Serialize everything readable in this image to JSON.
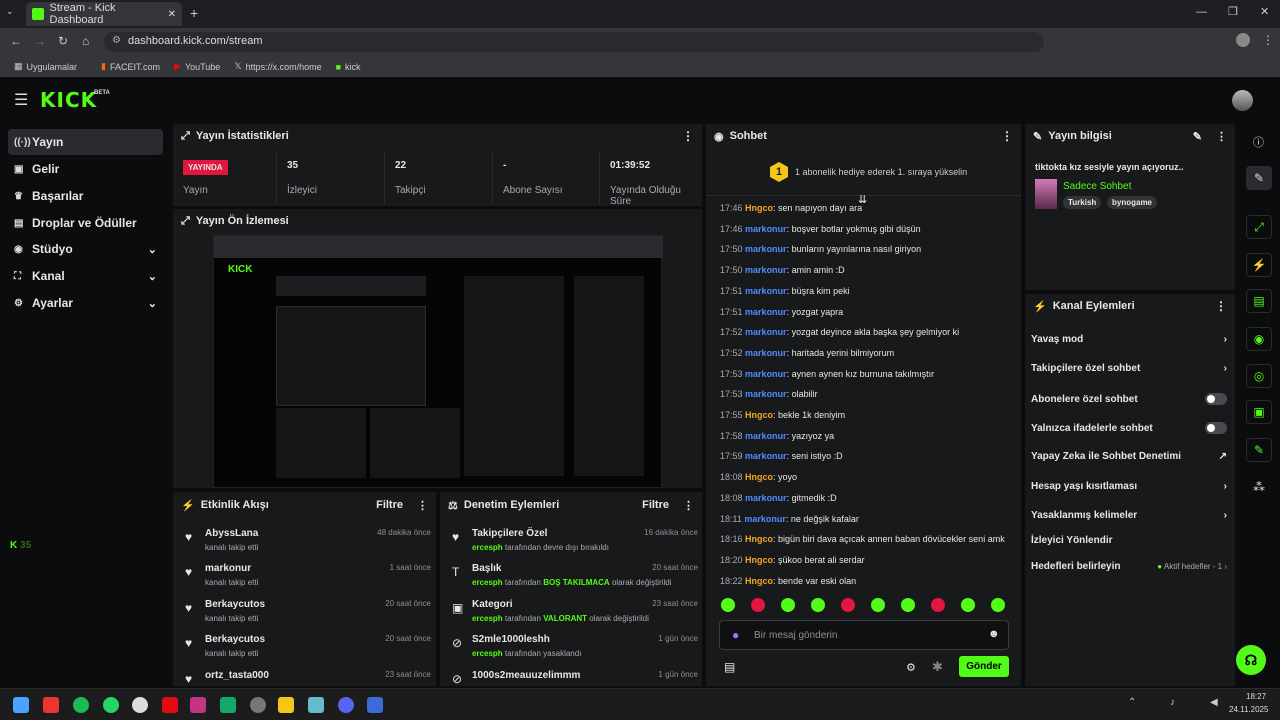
{
  "browser": {
    "tab_title": "Stream - Kick Dashboard",
    "url": "dashboard.kick.com/stream",
    "bookmarks": [
      "Uygulamalar",
      "FACEIT.com",
      "YouTube",
      "https://x.com/home",
      "kick"
    ]
  },
  "app": {
    "logo": "KICK",
    "logo_beta": "BETA"
  },
  "sidebar": {
    "items": [
      {
        "label": "Yayın",
        "icon": "broadcast-icon"
      },
      {
        "label": "Gelir",
        "icon": "wallet-icon"
      },
      {
        "label": "Başarılar",
        "icon": "trophy-icon"
      },
      {
        "label": "Droplar ve Ödüller",
        "icon": "gift-icon"
      },
      {
        "label": "Stüdyo",
        "icon": "studio-icon"
      },
      {
        "label": "Kanal",
        "icon": "channel-icon"
      },
      {
        "label": "Ayarlar",
        "icon": "gear-icon"
      }
    ],
    "footer_count": "35"
  },
  "stats": {
    "title": "Yayın İstatistikleri",
    "status_badge": "YAYINDA",
    "status_label": "Yayın",
    "viewers": "35",
    "viewers_label": "İzleyici",
    "followers": "22",
    "followers_label": "Takipçi",
    "subs": "-",
    "subs_label": "Abone Sayısı",
    "uptime": "01:39:52",
    "uptime_label": "Yayında Olduğu Süre"
  },
  "preview": {
    "title": "Yayın Ön İzlemesi"
  },
  "activity": {
    "title": "Etkinlik Akışı",
    "filter": "Filtre",
    "items": [
      {
        "title": "AbyssLana",
        "sub": "kanalı takip etti",
        "time": "48 dakika önce"
      },
      {
        "title": "markonur",
        "sub": "kanalı takip etti",
        "time": "1 saat önce"
      },
      {
        "title": "Berkaycutos",
        "sub": "kanalı takip etti",
        "time": "20 saat önce"
      },
      {
        "title": "Berkaycutos",
        "sub": "kanalı takip etti",
        "time": "20 saat önce"
      },
      {
        "title": "ortz_tasta000",
        "sub": "",
        "time": "23 saat önce"
      }
    ]
  },
  "moderation": {
    "title": "Denetim Eylemleri",
    "filter": "Filtre",
    "items": [
      {
        "title": "Takipçilere Özel",
        "user": "ercesph",
        "sub": "tarafından devre dışı bırakıldı",
        "time": "16 dakika önce"
      },
      {
        "title": "Başlık",
        "user": "ercesph",
        "sub": "tarafından",
        "value": "BOŞ TAKILMACA",
        "sub2": "olarak değiştirildi",
        "time": "20 saat önce"
      },
      {
        "title": "Kategori",
        "user": "ercesph",
        "sub": "tarafından",
        "value": "VALORANT",
        "sub2": "olarak değiştirildi",
        "time": "23 saat önce"
      },
      {
        "title": "S2mle1000leshh",
        "user": "ercesph",
        "sub": "tarafından yasaklandı",
        "time": "1 gün önce"
      },
      {
        "title": "1000s2meauuzelimmm",
        "user": "",
        "sub": "",
        "time": "1 gün önce"
      }
    ]
  },
  "chat": {
    "title": "Sohbet",
    "banner": "1 abonelik hediye ederek 1. sıraya yükselin",
    "banner_num": "1",
    "placeholder": "Bir mesaj gönderin",
    "send": "Gönder",
    "messages": [
      {
        "t": "17:46",
        "u": "Hngco",
        "m": ": sen napıyon dayı ara",
        "o": true
      },
      {
        "t": "17:46",
        "u": "markonur",
        "m": ": boşver botlar yokmuş gibi düşün"
      },
      {
        "t": "17:50",
        "u": "markonur",
        "m": ": bunların yayınlarına nasıl giriyon"
      },
      {
        "t": "17:50",
        "u": "markonur",
        "m": ": amin amin :D"
      },
      {
        "t": "17:51",
        "u": "markonur",
        "m": ": büşra kim peki"
      },
      {
        "t": "17:51",
        "u": "markonur",
        "m": ": yozgat yapra"
      },
      {
        "t": "17:52",
        "u": "markonur",
        "m": ": yozgat deyince akla başka şey gelmiyor ki"
      },
      {
        "t": "17:52",
        "u": "markonur",
        "m": ": haritada yerini bilmiyorum"
      },
      {
        "t": "17:53",
        "u": "markonur",
        "m": ": aynen aynen kız burnuna takılmıştır"
      },
      {
        "t": "17:53",
        "u": "markonur",
        "m": ": olabilir"
      },
      {
        "t": "17:55",
        "u": "Hngco",
        "m": ": bekle 1k deniyim",
        "o": true
      },
      {
        "t": "17:58",
        "u": "markonur",
        "m": ": yazıyoz ya"
      },
      {
        "t": "17:59",
        "u": "markonur",
        "m": ": seni istiyo :D"
      },
      {
        "t": "18:08",
        "u": "Hngco",
        "m": ": yoyo",
        "o": true
      },
      {
        "t": "18:08",
        "u": "markonur",
        "m": ": gitmedik :D"
      },
      {
        "t": "18:11",
        "u": "markonur",
        "m": ": ne değşik kafalar"
      },
      {
        "t": "18:16",
        "u": "Hngco",
        "m": ": bigün biri dava açıcak annen baban dövücekler seni amk",
        "o": true
      },
      {
        "t": "18:20",
        "u": "Hngco",
        "m": ": şükoo berat ali serdar",
        "o": true
      },
      {
        "t": "18:22",
        "u": "Hngco",
        "m": ": bende var eski olan",
        "o": true
      }
    ]
  },
  "info": {
    "title": "Yayın bilgisi",
    "stream_title": "tiktokta kız sesiyle yayın açıyoruz..",
    "category": "Sadece Sohbet",
    "tags": [
      "Turkish",
      "bynogame"
    ]
  },
  "actions": {
    "title": "Kanal Eylemleri",
    "items": [
      {
        "label": "Yavaş mod",
        "kind": "chevron"
      },
      {
        "label": "Takipçilere özel sohbet",
        "kind": "chevron"
      },
      {
        "label": "Abonelere özel sohbet",
        "kind": "toggle"
      },
      {
        "label": "Yalnızca ifadelerle sohbet",
        "kind": "toggle"
      },
      {
        "label": "Yapay Zeka ile Sohbet Denetimi",
        "kind": "external"
      },
      {
        "label": "Hesap yaşı kısıtlaması",
        "kind": "chevron"
      },
      {
        "label": "Yasaklanmış kelimeler",
        "kind": "chevron"
      },
      {
        "label": "İzleyici Yönlendir",
        "kind": "none"
      },
      {
        "label": "Hedefleri belirleyin",
        "kind": "chevron",
        "extra": "Aktif hedefler - 1"
      }
    ]
  },
  "taskbar": {
    "time": "18:27",
    "date": "24.11.2025"
  }
}
